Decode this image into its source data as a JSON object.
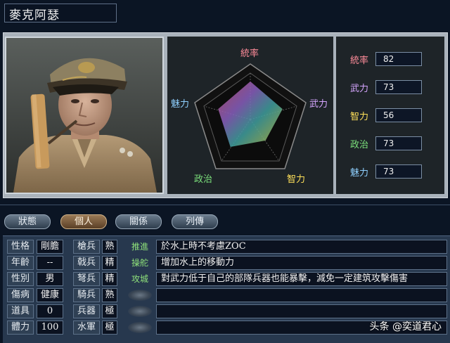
{
  "character": {
    "name": "麥克阿瑟"
  },
  "radar": {
    "labels": {
      "tong": "統率",
      "wu": "武力",
      "zhi": "智力",
      "zheng": "政治",
      "mei": "魅力"
    }
  },
  "stats": [
    {
      "label": "統率",
      "value": "82",
      "color": "#ff8c9a"
    },
    {
      "label": "武力",
      "value": "73",
      "color": "#d6a6ff"
    },
    {
      "label": "智力",
      "value": "56",
      "color": "#ffe15a"
    },
    {
      "label": "政治",
      "value": "73",
      "color": "#7be07b"
    },
    {
      "label": "魅力",
      "value": "73",
      "color": "#8fd0ff"
    }
  ],
  "tabs": [
    "狀態",
    "個人",
    "關係",
    "列傳"
  ],
  "profile": [
    {
      "label": "性格",
      "value": "剛膽"
    },
    {
      "label": "年齡",
      "value": "--"
    },
    {
      "label": "性別",
      "value": "男"
    },
    {
      "label": "傷病",
      "value": "健康"
    },
    {
      "label": "道具",
      "value": "0"
    },
    {
      "label": "體力",
      "value": "100"
    }
  ],
  "troops": [
    {
      "label": "槍兵",
      "value": "熟"
    },
    {
      "label": "戟兵",
      "value": "精"
    },
    {
      "label": "弩兵",
      "value": "精"
    },
    {
      "label": "騎兵",
      "value": "熟"
    },
    {
      "label": "兵器",
      "value": "極"
    },
    {
      "label": "水軍",
      "value": "極"
    }
  ],
  "skills": [
    {
      "tag": "推進",
      "desc": "於水上時不考慮ZOC"
    },
    {
      "tag": "操舵",
      "desc": "增加水上的移動力"
    },
    {
      "tag": "攻城",
      "desc": "對武力低于自己的部隊兵器也能暴擊，減免一定建筑攻擊傷害"
    },
    {
      "tag": "",
      "desc": ""
    },
    {
      "tag": "",
      "desc": ""
    },
    {
      "tag": "",
      "desc": ""
    }
  ],
  "watermark": "头条 @奕道君心"
}
